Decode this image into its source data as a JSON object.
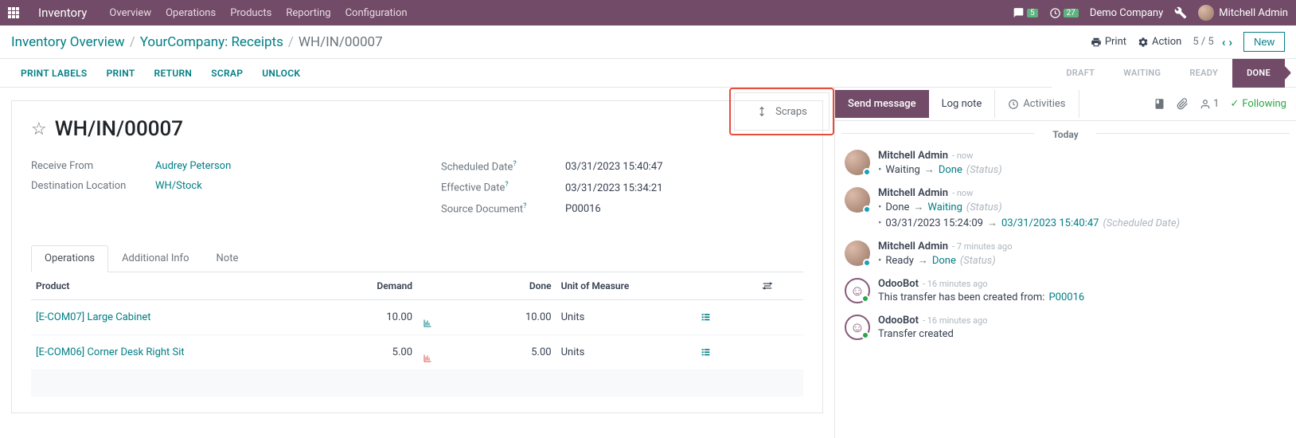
{
  "topnav": {
    "brand": "Inventory",
    "links": [
      "Overview",
      "Operations",
      "Products",
      "Reporting",
      "Configuration"
    ],
    "chat_count": "5",
    "clock_count": "27",
    "company": "Demo Company",
    "user": "Mitchell Admin"
  },
  "breadcrumb": {
    "p1": "Inventory Overview",
    "p2": "YourCompany: Receipts",
    "current": "WH/IN/00007"
  },
  "controls": {
    "print": "Print",
    "action": "Action",
    "pager": "5 / 5",
    "new": "New"
  },
  "actions": [
    "PRINT LABELS",
    "PRINT",
    "RETURN",
    "SCRAP",
    "UNLOCK"
  ],
  "status_steps": [
    "DRAFT",
    "WAITING",
    "READY",
    "DONE"
  ],
  "smart_button": {
    "label": "Scraps"
  },
  "doc": {
    "title": "WH/IN/00007",
    "receive_from_label": "Receive From",
    "receive_from": "Audrey Peterson",
    "dest_label": "Destination Location",
    "dest": "WH/Stock",
    "sched_label": "Scheduled Date",
    "sched": "03/31/2023 15:40:47",
    "eff_label": "Effective Date",
    "eff": "03/31/2023 15:34:21",
    "src_label": "Source Document",
    "src": "P00016"
  },
  "tabs": [
    "Operations",
    "Additional Info",
    "Note"
  ],
  "table": {
    "headers": {
      "product": "Product",
      "demand": "Demand",
      "done": "Done",
      "uom": "Unit of Measure"
    },
    "rows": [
      {
        "product": "[E-COM07] Large Cabinet",
        "demand": "10.00",
        "done": "10.00",
        "uom": "Units",
        "chart_red": false
      },
      {
        "product": "[E-COM06] Corner Desk Right Sit",
        "demand": "5.00",
        "done": "5.00",
        "uom": "Units",
        "chart_red": true
      }
    ]
  },
  "chatter": {
    "send": "Send message",
    "lognote": "Log note",
    "activities": "Activities",
    "follower_count": "1",
    "following": "Following",
    "today": "Today",
    "messages": [
      {
        "author": "Mitchell Admin",
        "time": "now",
        "bot": false,
        "lines": [
          {
            "bullet": true,
            "pre": "Waiting",
            "arrow": true,
            "link": "Done",
            "post": "(Status)"
          }
        ]
      },
      {
        "author": "Mitchell Admin",
        "time": "now",
        "bot": false,
        "lines": [
          {
            "bullet": true,
            "pre": "Done",
            "arrow": true,
            "link": "Waiting",
            "post": "(Status)"
          },
          {
            "bullet": true,
            "pre": "03/31/2023 15:24:09",
            "arrow": true,
            "link": "03/31/2023 15:40:47",
            "post": "(Scheduled Date)"
          }
        ]
      },
      {
        "author": "Mitchell Admin",
        "time": "7 minutes ago",
        "bot": false,
        "lines": [
          {
            "bullet": true,
            "pre": "Ready",
            "arrow": true,
            "link": "Done",
            "post": "(Status)"
          }
        ]
      },
      {
        "author": "OdooBot",
        "time": "16 minutes ago",
        "bot": true,
        "lines": [
          {
            "bullet": false,
            "pre": "This transfer has been created from: ",
            "arrow": false,
            "link": "P00016",
            "post": ""
          }
        ]
      },
      {
        "author": "OdooBot",
        "time": "16 minutes ago",
        "bot": true,
        "lines": [
          {
            "bullet": false,
            "pre": "Transfer created",
            "arrow": false,
            "link": "",
            "post": ""
          }
        ]
      }
    ]
  }
}
